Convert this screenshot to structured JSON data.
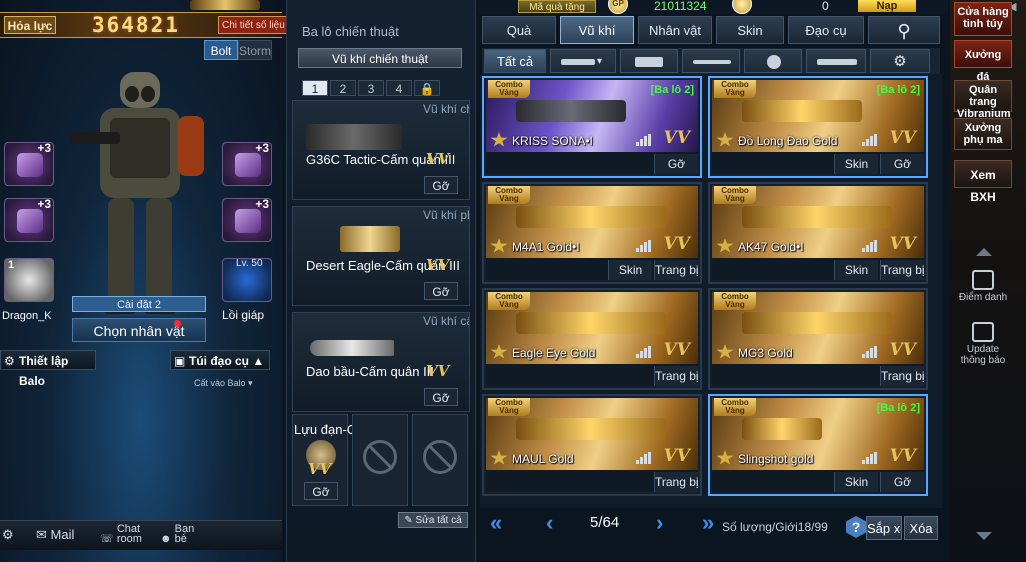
{
  "character": {
    "power_label": "Hỏa lực",
    "power_value": "364821",
    "detail_button": "Chi tiết số liệu",
    "tabs": [
      "Bolt",
      "Storm"
    ],
    "slot_plus": "+3",
    "slot_number": "1",
    "companion_name": "Dragon_K",
    "level": "Lv. 50",
    "armor_label": "Lồi giáp",
    "setting_label": "Cài đặt 2",
    "choose_button": "Chọn nhân vật",
    "backpack_setup": "Thiết lập Balo",
    "item_bag": "Túi đạo cụ",
    "put_in_bag": "Cất vào Balo"
  },
  "bottom_bar": {
    "mail": "Mail",
    "chat": "Chat room",
    "friends": "Bạn bè"
  },
  "loadout": {
    "heading": "Ba lô chiến thuật",
    "dropdown": "Vũ khí chiến thuật",
    "pages": [
      "1",
      "2",
      "3",
      "4"
    ],
    "slots": [
      {
        "category": "Vũ khí chính",
        "name": "G36C Tactic-Cấm quân III",
        "button": "Gỡ"
      },
      {
        "category": "Vũ khí phụ",
        "name": "Desert Eagle-Cấm quân III",
        "button": "Gỡ"
      },
      {
        "category": "Vũ khí cận chiến",
        "name": "Dao bầu-Cấm quân III",
        "button": "Gỡ"
      }
    ],
    "grenade_label": "Lựu đạn-Cấm quân",
    "grenade_button": "Gỡ",
    "edit_all": "Sửa tất cả",
    "vv": "VV"
  },
  "currency": {
    "gift_code": "Mã quà tặng",
    "gp_icon": "GP",
    "gp_value": "21011324",
    "cash_value": "0",
    "topup": "Nạp"
  },
  "tabs": {
    "main": [
      "Quà",
      "Vũ khí",
      "Nhân vật",
      "Skin",
      "Đạo cụ"
    ],
    "active": "Vũ khí",
    "filter_all": "Tất cả"
  },
  "cards": [
    {
      "name": "KRISS SONA•I",
      "balo": "[Ba lô 2]",
      "buttons": [
        "Gỡ"
      ],
      "style": "purple"
    },
    {
      "name": "Đồ Long Đao Gold",
      "balo": "[Ba lô 2]",
      "buttons": [
        "Skin",
        "Gỡ"
      ],
      "style": "gold"
    },
    {
      "name": "M4A1 Gold•I",
      "balo": "",
      "buttons": [
        "Skin",
        "Trang bị"
      ],
      "style": "gold"
    },
    {
      "name": "AK47 Gold•I",
      "balo": "",
      "buttons": [
        "Skin",
        "Trang bị"
      ],
      "style": "gold"
    },
    {
      "name": "Eagle Eye Gold",
      "balo": "",
      "buttons": [
        "Trang bị"
      ],
      "style": "gold"
    },
    {
      "name": "MG3 Gold",
      "balo": "",
      "buttons": [
        "Trang bị"
      ],
      "style": "gold"
    },
    {
      "name": "MAUL Gold",
      "balo": "",
      "buttons": [
        "Trang bị"
      ],
      "style": "gold"
    },
    {
      "name": "Slingshot gold",
      "balo": "[Ba lô 2]",
      "buttons": [
        "Skin",
        "Gỡ"
      ],
      "style": "gold"
    }
  ],
  "combo_badge": [
    "Combo",
    "Vàng"
  ],
  "pagination": {
    "page": "5/64",
    "count_label": "Số lượng/Giới",
    "count_value": "18/99",
    "help": "?",
    "sort": "Sắp xếp",
    "delete": "Xóa"
  },
  "right_column": {
    "shop": "Cửa hàng tinh túy",
    "forge": "Xưởng đá",
    "vibranium": "Quân trang Vibranium",
    "weapon_forge": "Xưởng phụ ma",
    "ranking": "Xem BXH",
    "review": "Điểm danh",
    "update": "Update thông báo"
  }
}
